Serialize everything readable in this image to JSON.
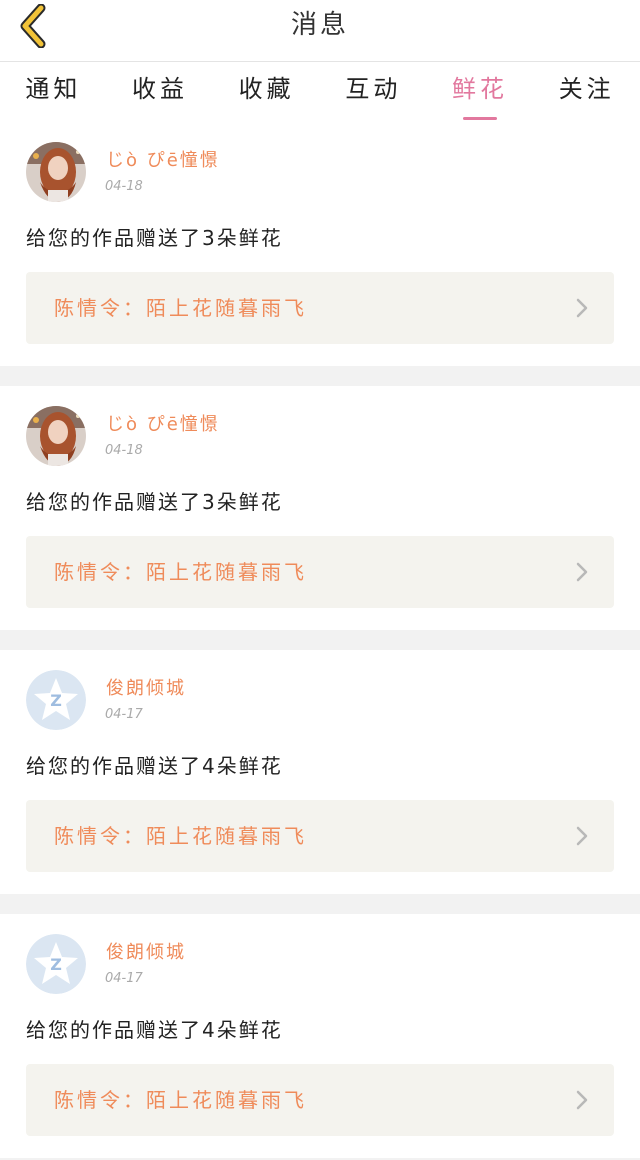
{
  "header": {
    "title": "消息"
  },
  "tabs": [
    {
      "label": "通知",
      "active": false
    },
    {
      "label": "收益",
      "active": false
    },
    {
      "label": "收藏",
      "active": false
    },
    {
      "label": "互动",
      "active": false
    },
    {
      "label": "鲜花",
      "active": true
    },
    {
      "label": "关注",
      "active": false
    }
  ],
  "notifications": [
    {
      "username": "じò ぴē憧憬",
      "date": "04-18",
      "message": "给您的作品赠送了3朵鲜花",
      "work_title": "陈情令：陌上花随暮雨飞",
      "avatar": "photo-avatar"
    },
    {
      "username": "じò ぴē憧憬",
      "date": "04-18",
      "message": "给您的作品赠送了3朵鲜花",
      "work_title": "陈情令：陌上花随暮雨飞",
      "avatar": "photo-avatar"
    },
    {
      "username": "俊朗倾城",
      "date": "04-17",
      "message": "给您的作品赠送了4朵鲜花",
      "work_title": "陈情令：陌上花随暮雨飞",
      "avatar": "qq-default-avatar"
    },
    {
      "username": "俊朗倾城",
      "date": "04-17",
      "message": "给您的作品赠送了4朵鲜花",
      "work_title": "陈情令：陌上花随暮雨飞",
      "avatar": "qq-default-avatar"
    }
  ],
  "colors": {
    "accent_pink": "#e2789e",
    "username_orange": "#ef8b5a",
    "back_icon_yellow": "#f2c338",
    "link_bg": "#f4f3ee"
  },
  "icons": {
    "back": "chevron-left-icon",
    "link_arrow": "chevron-right-icon"
  }
}
